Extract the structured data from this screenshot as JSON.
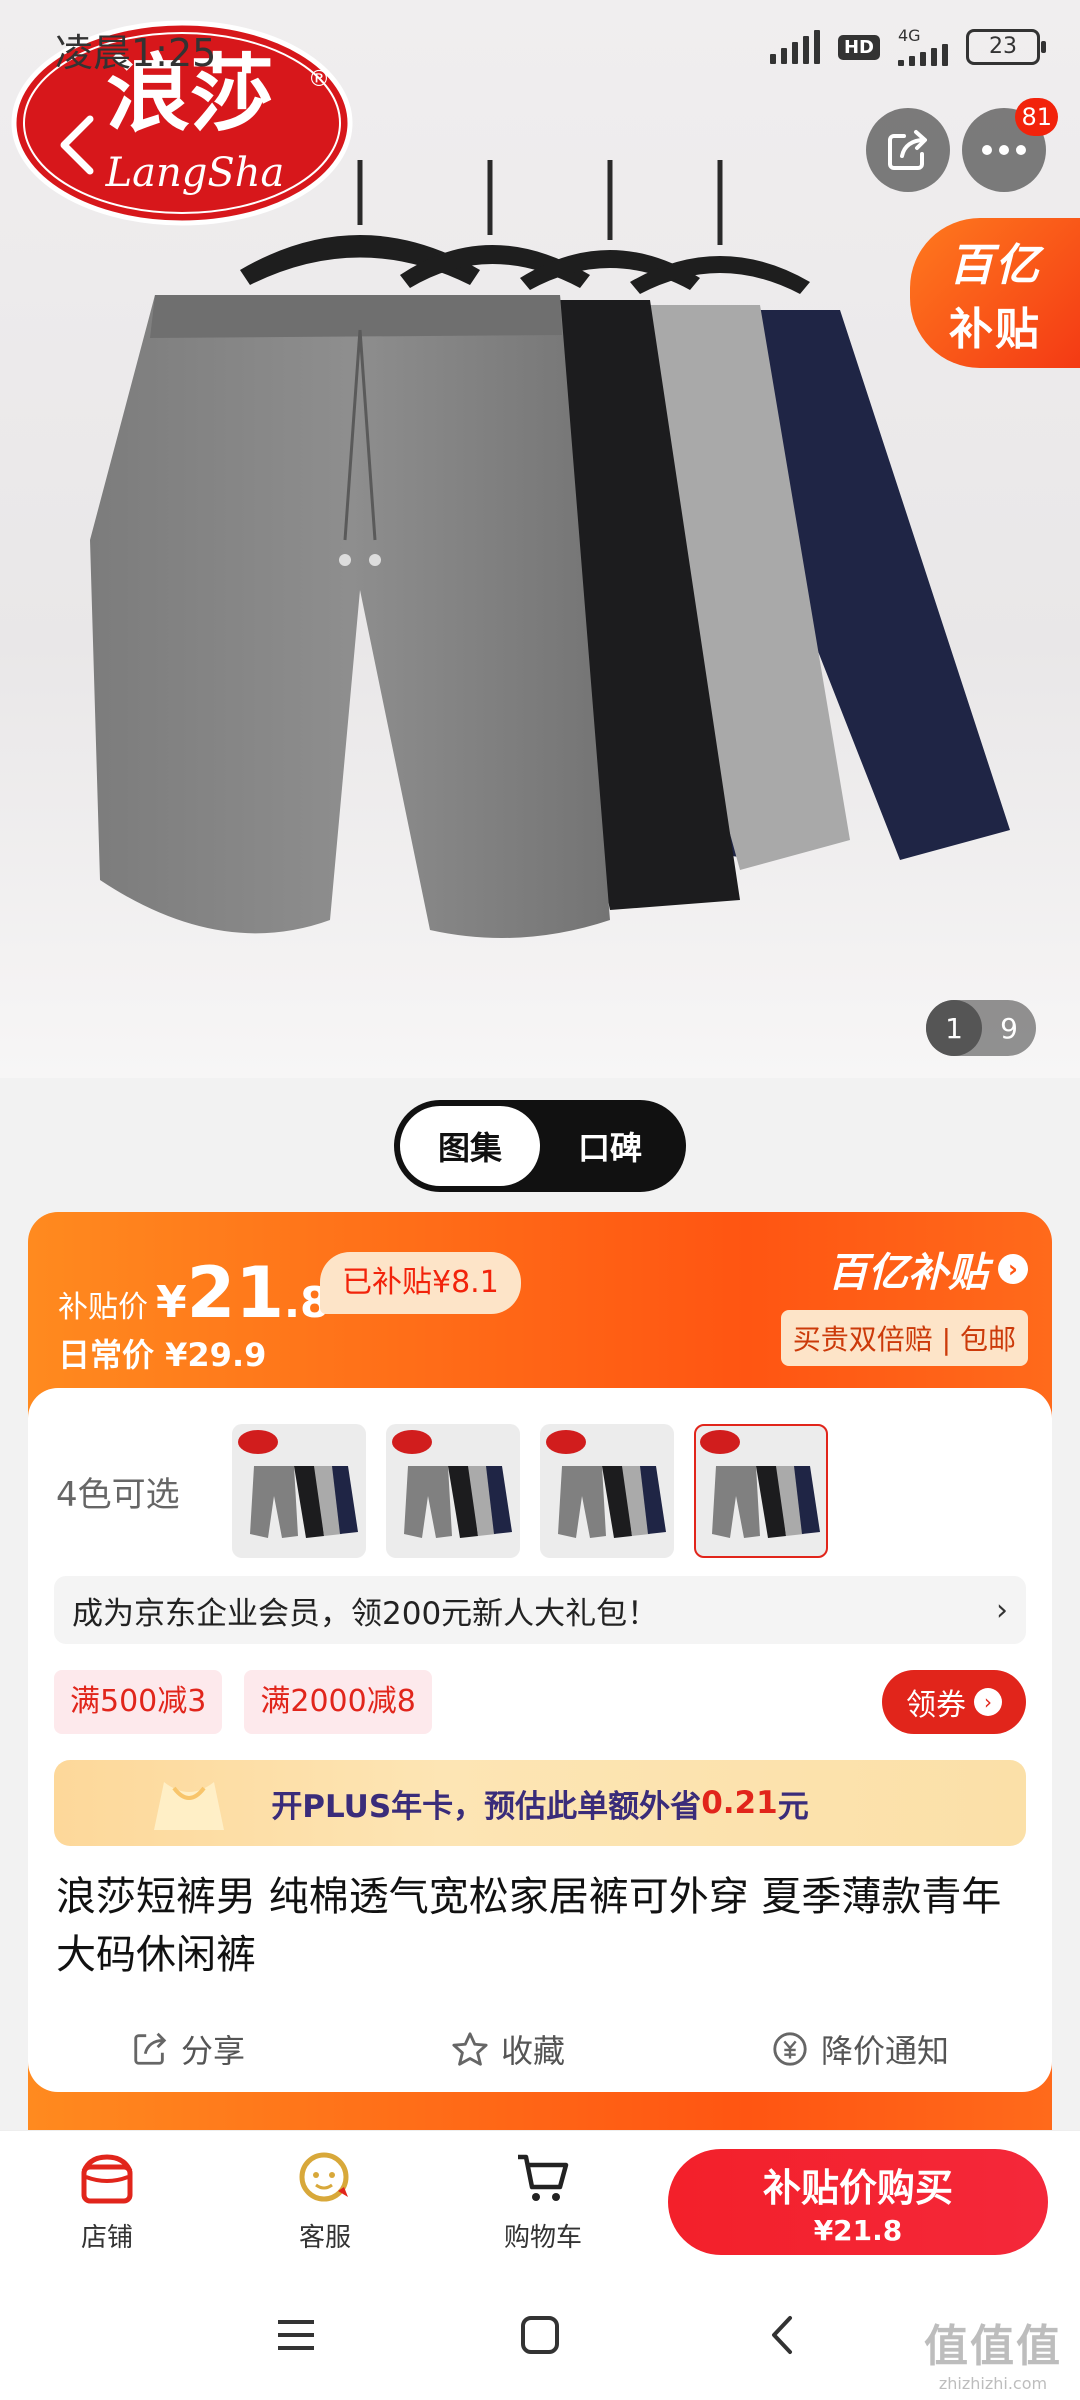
{
  "status_bar": {
    "time": "凌晨1:25",
    "battery": "23",
    "network": "4G",
    "hd": "HD"
  },
  "header": {
    "brand_logo_text": "浪莎",
    "brand_logo_sub": "LangSha",
    "more_badge": "81"
  },
  "hero": {
    "subsidy_tag_line1": "百亿",
    "subsidy_tag_line2": "补贴",
    "pager_current": "1",
    "pager_total": "9",
    "short_colors": [
      "#8a8a8a",
      "#1c1c1e",
      "#a9a9a9",
      "#1f2545"
    ]
  },
  "gallery_tabs": [
    {
      "label": "图集",
      "active": true
    },
    {
      "label": "口碑",
      "active": false
    }
  ],
  "price": {
    "label": "补贴价",
    "currency": "¥",
    "integer": "21",
    "decimal": ".8",
    "subsidized": "已补贴¥8.1",
    "daily_label": "日常价 ¥29.9",
    "brand_title": "百亿补贴",
    "brand_sub": "买贵双倍赔 | 包邮"
  },
  "colors": {
    "label": "4色可选",
    "selected_index": 3,
    "count": 4
  },
  "vip_bar": {
    "text": "成为京东企业会员，领200元新人大礼包！",
    "arrow": "›"
  },
  "coupons": {
    "items": [
      "满500减3",
      "满2000减8"
    ],
    "get_label": "领券"
  },
  "plus_bar": {
    "text_before": "开PLUS年卡，预估此单额外省",
    "amount": "0.21",
    "unit": "元"
  },
  "product_title": "浪莎短裤男 纯棉透气宽松家居裤可外穿 夏季薄款青年大码休闲裤",
  "actions": {
    "share": "分享",
    "favorite": "收藏",
    "price_alert": "降价通知"
  },
  "bottom_bar": {
    "store": "店铺",
    "service": "客服",
    "cart": "购物车",
    "buy_line1": "补贴价购买",
    "buy_line2": "¥21.8"
  },
  "watermark": {
    "main": "值值值",
    "sub": "zhizhizhi.com"
  },
  "accent_colors": {
    "jd_red": "#e1251b",
    "subsidy_orange": "#ff5512"
  }
}
